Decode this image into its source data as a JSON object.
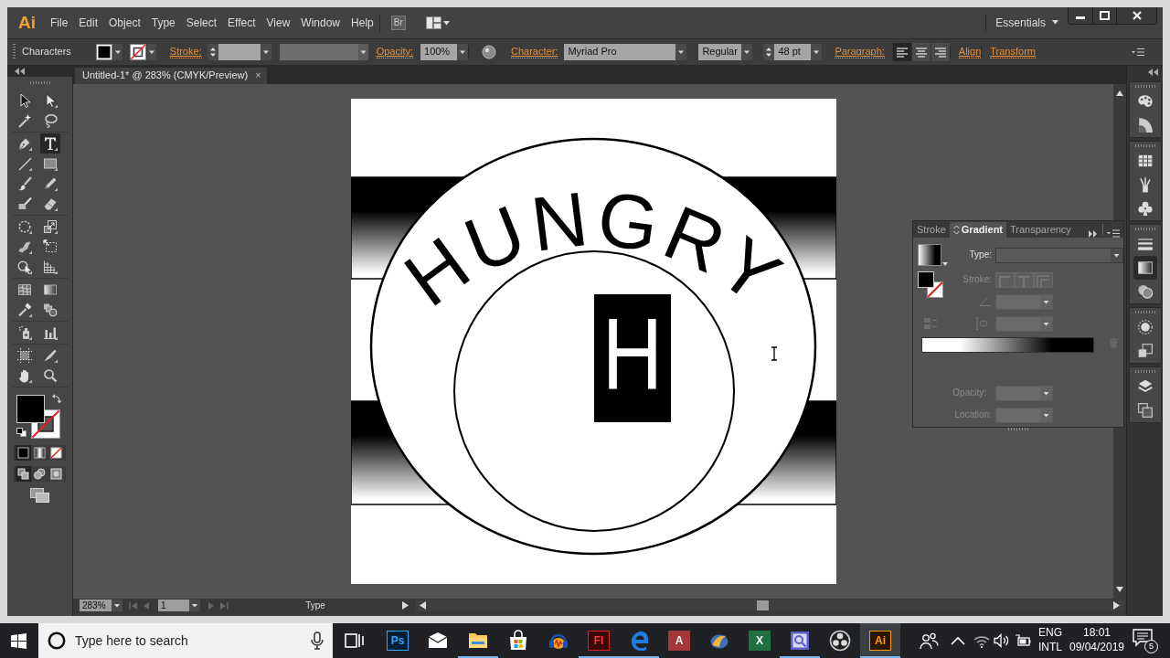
{
  "menu_bar": {
    "logo": "Ai",
    "items": [
      "File",
      "Edit",
      "Object",
      "Type",
      "Select",
      "Effect",
      "View",
      "Window",
      "Help"
    ],
    "bridge": "Br",
    "workspace": "Essentials"
  },
  "control_bar": {
    "selection": "Characters",
    "stroke_label": "Stroke:",
    "opacity_label": "Opacity:",
    "opacity": "100%",
    "character_label": "Character:",
    "font_family": "Myriad Pro",
    "font_style": "Regular",
    "font_size": "48 pt",
    "paragraph_label": "Paragraph:",
    "alignment": [
      {
        "kind": "left",
        "selected": true
      },
      {
        "kind": "center",
        "selected": false
      },
      {
        "kind": "right",
        "selected": false
      }
    ],
    "align": "Align",
    "transform": "Transform"
  },
  "document_tab": {
    "title": "Untitled-1* @ 283% (CMYK/Preview)",
    "close": "×"
  },
  "toolbox": {
    "groups": [
      {
        "tools": [
          {
            "kind": "selection",
            "flyout": false,
            "selected": false
          },
          {
            "kind": "direct-selection",
            "flyout": true,
            "selected": false
          },
          {
            "kind": "magic-wand",
            "flyout": false,
            "selected": false
          },
          {
            "kind": "lasso",
            "flyout": false,
            "selected": false
          }
        ]
      },
      {
        "tools": [
          {
            "kind": "pen",
            "flyout": true,
            "selected": false
          },
          {
            "kind": "type",
            "flyout": true,
            "selected": true
          },
          {
            "kind": "line",
            "flyout": true,
            "selected": false
          },
          {
            "kind": "rectangle",
            "flyout": true,
            "selected": false
          },
          {
            "kind": "paintbrush",
            "flyout": false,
            "selected": false
          },
          {
            "kind": "pencil",
            "flyout": true,
            "selected": false
          },
          {
            "kind": "blob-brush",
            "flyout": false,
            "selected": false
          },
          {
            "kind": "eraser",
            "flyout": true,
            "selected": false
          }
        ]
      },
      {
        "tools": [
          {
            "kind": "rotate",
            "flyout": true,
            "selected": false
          },
          {
            "kind": "scale",
            "flyout": true,
            "selected": false
          },
          {
            "kind": "warp",
            "flyout": true,
            "selected": false
          },
          {
            "kind": "free-transform",
            "flyout": false,
            "selected": false
          },
          {
            "kind": "shape-builder",
            "flyout": true,
            "selected": false
          },
          {
            "kind": "perspective-grid",
            "flyout": true,
            "selected": false
          }
        ]
      },
      {
        "tools": [
          {
            "kind": "mesh",
            "flyout": false,
            "selected": false
          },
          {
            "kind": "gradient",
            "flyout": false,
            "selected": false
          },
          {
            "kind": "eyedropper",
            "flyout": true,
            "selected": false
          },
          {
            "kind": "blend",
            "flyout": false,
            "selected": false
          }
        ]
      },
      {
        "tools": [
          {
            "kind": "symbol-sprayer",
            "flyout": true,
            "selected": false
          },
          {
            "kind": "column-graph",
            "flyout": true,
            "selected": false
          }
        ]
      },
      {
        "tools": [
          {
            "kind": "artboard",
            "flyout": false,
            "selected": false
          },
          {
            "kind": "slice",
            "flyout": true,
            "selected": false
          },
          {
            "kind": "hand",
            "flyout": true,
            "selected": false
          },
          {
            "kind": "zoom",
            "flyout": false,
            "selected": false
          }
        ]
      }
    ],
    "color_modes": [
      {
        "kind": "color",
        "selected": true
      },
      {
        "kind": "gradient",
        "selected": false
      },
      {
        "kind": "none",
        "selected": false
      }
    ],
    "draw_modes": [
      {
        "kind": "normal",
        "selected": true
      },
      {
        "kind": "behind",
        "selected": false
      },
      {
        "kind": "inside",
        "selected": false
      }
    ]
  },
  "artwork": {
    "arc_text": "HUNGRY",
    "monogram": "H"
  },
  "gradient_panel": {
    "tabs": [
      {
        "label": "Stroke",
        "selected": false
      },
      {
        "label": "Gradient",
        "selected": true
      },
      {
        "label": "Transparency",
        "selected": false
      }
    ],
    "type": {
      "label": "Type:",
      "disabled": false
    },
    "stroke": {
      "label": "Stroke:",
      "disabled": true
    },
    "angle_field": {
      "disabled": true
    },
    "aspect_field": {
      "disabled": true
    },
    "opacity": {
      "label": "Opacity:",
      "disabled": true
    },
    "location": {
      "label": "Location:",
      "disabled": true
    }
  },
  "dock": {
    "groups": [
      {
        "panels": [
          {
            "kind": "color",
            "selected": false
          },
          {
            "kind": "color-guide",
            "selected": false
          }
        ]
      },
      {
        "panels": [
          {
            "kind": "swatches",
            "selected": false
          },
          {
            "kind": "brushes",
            "selected": false
          },
          {
            "kind": "symbols",
            "selected": false
          }
        ]
      },
      {
        "panels": [
          {
            "kind": "stroke",
            "selected": false
          },
          {
            "kind": "gradient",
            "selected": true
          },
          {
            "kind": "transparency",
            "selected": false
          }
        ]
      },
      {
        "panels": [
          {
            "kind": "appearance",
            "selected": false
          },
          {
            "kind": "graphic-styles",
            "selected": false
          }
        ]
      },
      {
        "panels": [
          {
            "kind": "layers",
            "selected": false
          },
          {
            "kind": "artboards",
            "selected": false
          }
        ]
      }
    ]
  },
  "status_bar": {
    "zoom": "283%",
    "artboard": "1",
    "tool": "Type"
  },
  "taskbar": {
    "search_placeholder": "Type here to search",
    "apps": [
      {
        "kind": "photoshop",
        "glyph": "Ps",
        "running": false,
        "active": false
      },
      {
        "kind": "mail",
        "running": false,
        "active": false
      },
      {
        "kind": "explorer",
        "running": true,
        "active": false
      },
      {
        "kind": "store",
        "running": false,
        "active": false
      },
      {
        "kind": "audio",
        "running": false,
        "active": false
      },
      {
        "kind": "flash",
        "glyph": "Fl",
        "running": true,
        "active": false
      },
      {
        "kind": "edge",
        "running": true,
        "active": false
      },
      {
        "kind": "access",
        "glyph": "A",
        "running": false,
        "active": false
      },
      {
        "kind": "app",
        "running": false,
        "active": false
      },
      {
        "kind": "excel",
        "glyph": "X",
        "running": false,
        "active": false
      },
      {
        "kind": "viewer",
        "running": true,
        "active": false
      },
      {
        "kind": "obs",
        "running": false,
        "active": false
      },
      {
        "kind": "illustrator",
        "glyph": "Ai",
        "running": true,
        "active": true
      }
    ],
    "language": "ENG",
    "layout": "INTL",
    "time": "18:01",
    "date": "09/04/2019",
    "notification_count": "5"
  }
}
